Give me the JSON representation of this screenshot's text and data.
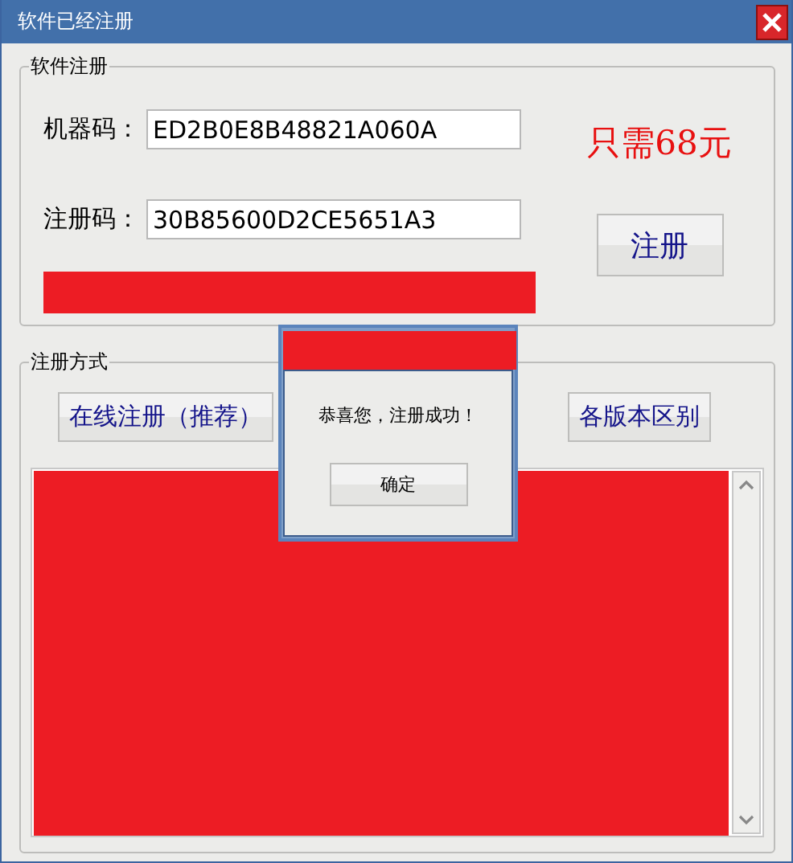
{
  "window": {
    "title": "软件已经注册"
  },
  "registration_group": {
    "legend": "软件注册",
    "fields": [
      {
        "label": "机器码：",
        "value": "ED2B0E8B48821A060A"
      },
      {
        "label": "注册码：",
        "value": "30B85600D2CE5651A3"
      }
    ],
    "price": "只需68元",
    "register_button": "注册"
  },
  "method_group": {
    "legend": "注册方式",
    "buttons": [
      "在线注册（推荐）",
      "各版本区别"
    ]
  },
  "dialog": {
    "message": "恭喜您，注册成功！",
    "ok_button": "确定"
  }
}
